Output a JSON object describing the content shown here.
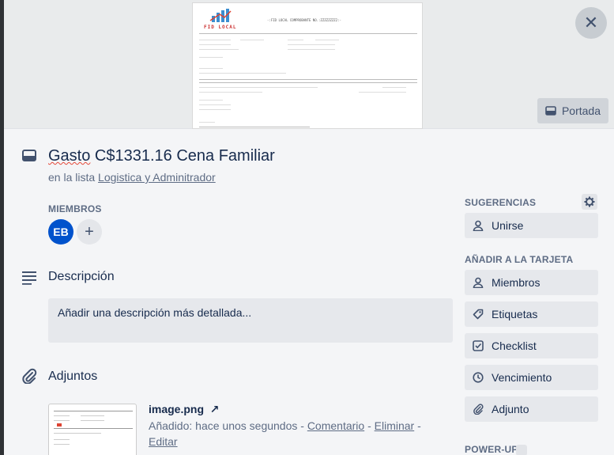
{
  "cover": {
    "button_label": "Portada",
    "doc_logo_text": "FID LOCAL",
    "doc_header_text": "-:FID LOCAL COMPROBANTE NO.:ZZZZZZZZ2:-"
  },
  "card": {
    "title_prefix": "Gasto",
    "title_rest": " C$1331.16 Cena Familiar",
    "in_list_prefix": "en la lista ",
    "list_name": "Logistica y Adminitrador"
  },
  "members": {
    "label": "MIEMBROS",
    "avatar_initials": "EB",
    "add_symbol": "+"
  },
  "description": {
    "title": "Descripción",
    "placeholder": "Añadir una descripción más detallada..."
  },
  "attachments": {
    "title": "Adjuntos",
    "file_name": "image.png",
    "open_symbol": "↗",
    "added_prefix": "Añadido: hace unos segundos - ",
    "comment_link": "Comentario",
    "sep1": " - ",
    "delete_link": "Eliminar",
    "sep2": " - ",
    "edit_link": "Editar"
  },
  "sidebar": {
    "suggestions_label": "SUGERENCIAS",
    "join_label": "Unirse",
    "add_to_card_label": "AÑADIR A LA TARJETA",
    "members_btn": "Miembros",
    "labels_btn": "Etiquetas",
    "checklist_btn": "Checklist",
    "due_btn": "Vencimiento",
    "attachment_btn": "Adjunto",
    "powerups_label": "POWER-UPS"
  },
  "colors": {
    "avatar_bg": "#0052cc",
    "modal_bg": "#f4f5f7",
    "button_bg": "#e6e8ec"
  }
}
